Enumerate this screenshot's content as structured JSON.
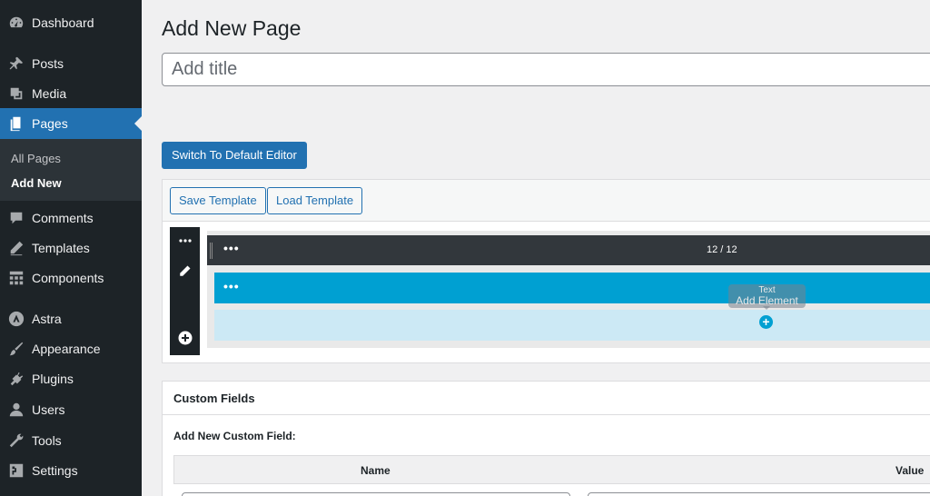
{
  "sidebar": {
    "items": [
      {
        "label": "Dashboard",
        "icon": "dashboard-icon"
      },
      {
        "label": "Posts",
        "icon": "pin-icon"
      },
      {
        "label": "Media",
        "icon": "media-icon"
      },
      {
        "label": "Pages",
        "icon": "pages-icon",
        "current": true
      },
      {
        "label": "Comments",
        "icon": "comment-icon"
      },
      {
        "label": "Templates",
        "icon": "pencil-icon"
      },
      {
        "label": "Components",
        "icon": "grid-icon"
      },
      {
        "label": "Astra",
        "icon": "astra-icon"
      },
      {
        "label": "Appearance",
        "icon": "brush-icon"
      },
      {
        "label": "Plugins",
        "icon": "plug-icon"
      },
      {
        "label": "Users",
        "icon": "user-icon"
      },
      {
        "label": "Tools",
        "icon": "wrench-icon"
      },
      {
        "label": "Settings",
        "icon": "settings-icon"
      }
    ],
    "submenu": [
      {
        "label": "All Pages"
      },
      {
        "label": "Add New",
        "active": true
      }
    ]
  },
  "main": {
    "heading": "Add New Page",
    "title_placeholder": "Add title",
    "switch_editor_label": "Switch To Default Editor"
  },
  "builder": {
    "save_template_label": "Save Template",
    "load_template_label": "Load Template",
    "row_dots": "•••",
    "column_ratio": "12 / 12",
    "column_dots": "•••",
    "tooltip_small": "Text",
    "tooltip_label": "Add Element"
  },
  "custom_fields": {
    "title": "Custom Fields",
    "add_new_label": "Add New Custom Field:",
    "col_name": "Name",
    "col_value": "Value"
  },
  "colors": {
    "sidebar_bg": "#1d2327",
    "accent": "#2271b1",
    "builder_blue": "#00a0d2"
  }
}
